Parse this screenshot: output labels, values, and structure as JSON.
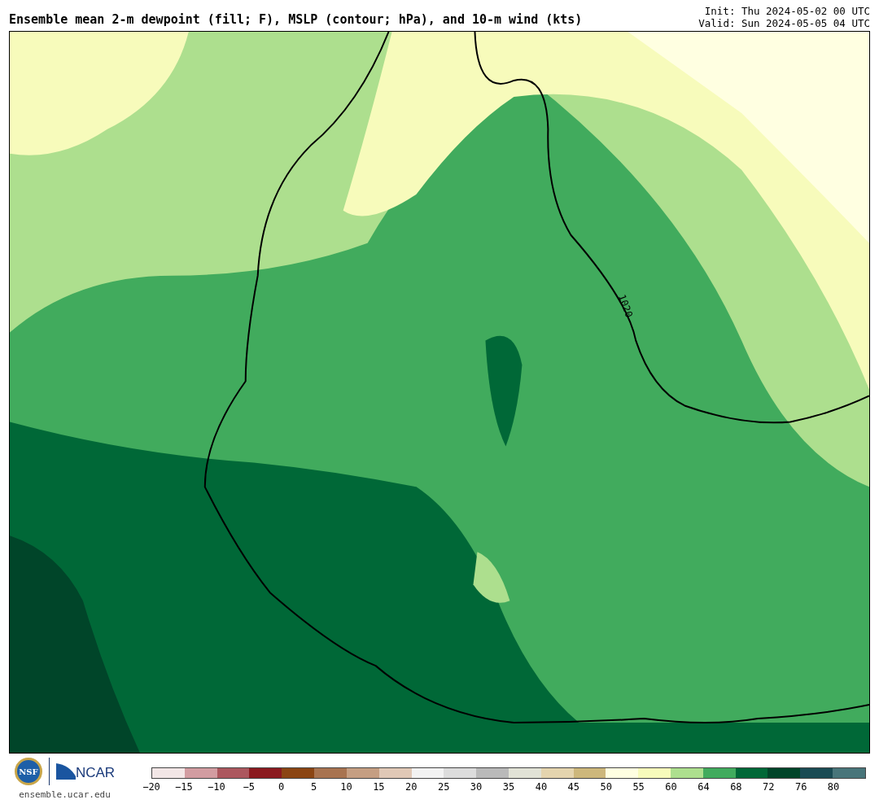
{
  "title": "Ensemble mean 2-m dewpoint (fill; F), MSLP (contour; hPa), and 10-m wind (kts)",
  "init": "Init: Thu 2024-05-02 00 UTC",
  "valid": "Valid: Sun 2024-05-05 04 UTC",
  "map": {
    "contour_label": "1020"
  },
  "logos": {
    "nsf": "NSF",
    "ncar": "NCAR",
    "url": "ensemble.ucar.edu"
  },
  "colorbar": {
    "segments": [
      {
        "color": "#f2e6e6"
      },
      {
        "color": "#d29ca1"
      },
      {
        "color": "#ac575e"
      },
      {
        "color": "#8b1a1f"
      },
      {
        "color": "#8b4513"
      },
      {
        "color": "#a87350"
      },
      {
        "color": "#c59e82"
      },
      {
        "color": "#e0c8b6"
      },
      {
        "color": "#f2f2f2"
      },
      {
        "color": "#dcdcdc"
      },
      {
        "color": "#b9b9b9"
      },
      {
        "color": "#e1e2d6"
      },
      {
        "color": "#e4d4ae"
      },
      {
        "color": "#cdb77b"
      },
      {
        "color": "#ffffe1"
      },
      {
        "color": "#f7fbbb"
      },
      {
        "color": "#addf8e"
      },
      {
        "color": "#41ab5d"
      },
      {
        "color": "#006837"
      },
      {
        "color": "#004529"
      },
      {
        "color": "#1a4b54"
      },
      {
        "color": "#48757a"
      }
    ],
    "ticks": [
      "−20",
      "−15",
      "−10",
      "−5",
      "0",
      "5",
      "10",
      "15",
      "20",
      "25",
      "30",
      "35",
      "40",
      "45",
      "50",
      "55",
      "60",
      "64",
      "68",
      "72",
      "76",
      "80"
    ]
  }
}
